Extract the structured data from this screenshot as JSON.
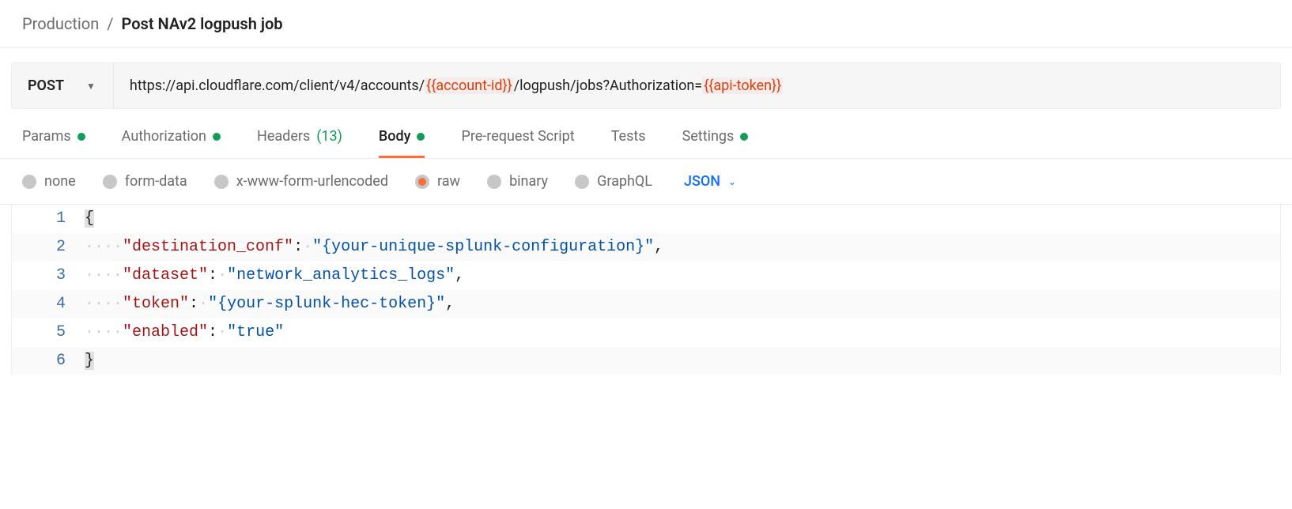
{
  "breadcrumb": {
    "parent": "Production",
    "sep": "/",
    "current": "Post NAv2 logpush job"
  },
  "request": {
    "method": "POST",
    "url_parts": {
      "p1": "https://api.cloudflare.com/client/v4/accounts/",
      "v1": "{{account-id}}",
      "p2": "/logpush/jobs?Authorization=",
      "v2": "{{api-token}}"
    }
  },
  "tabs": {
    "params": "Params",
    "auth": "Authorization",
    "headers": "Headers",
    "headers_count": "(13)",
    "body": "Body",
    "prerequest": "Pre-request Script",
    "tests": "Tests",
    "settings": "Settings"
  },
  "body_types": {
    "none": "none",
    "formdata": "form-data",
    "urlencoded": "x-www-form-urlencoded",
    "raw": "raw",
    "binary": "binary",
    "graphql": "GraphQL",
    "lang": "JSON"
  },
  "editor_lines": {
    "l1": "1",
    "l2": "2",
    "l3": "3",
    "l4": "4",
    "l5": "5",
    "l6": "6",
    "brace_open": "{",
    "brace_close": "}",
    "ws4": "····",
    "ws1": "·",
    "k1": "\"destination_conf\"",
    "v1": "\"{your-unique-splunk-configuration}\"",
    "k2": "\"dataset\"",
    "v2": "\"network_analytics_logs\"",
    "k3": "\"token\"",
    "v3": "\"{your-splunk-hec-token}\"",
    "k4": "\"enabled\"",
    "v4": "\"true\"",
    "colon": ":",
    "comma": ","
  }
}
